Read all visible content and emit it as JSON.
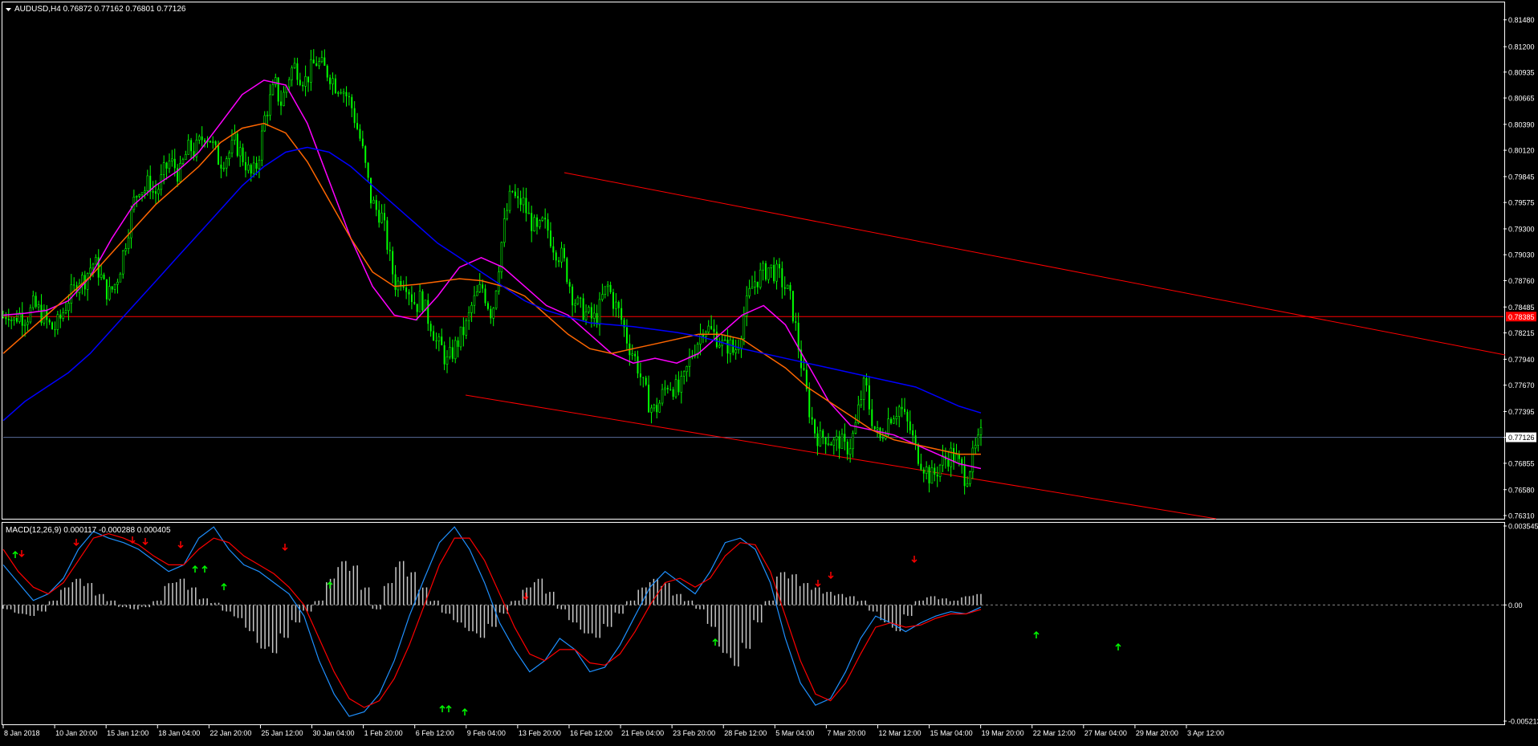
{
  "window": {
    "symbol_header": "AUDUSD,H4  0.76872 0.77162 0.76801 0.77126",
    "macd_header": "MACD(12,26,9) 0.000117 -0.000288 0.000405"
  },
  "colors": {
    "background": "#000000",
    "grid_border": "#ffffff",
    "candle_bull": "#00ff00",
    "candle_bear": "#00ff00",
    "ma_fast": "#ff00ff",
    "ma_mid": "#ff6600",
    "ma_slow": "#0000ff",
    "trend_lines": "#ff0000",
    "hline_price": "#ff0000",
    "hline_bid": "#5a6b9a",
    "macd_line": "#1e90ff",
    "signal_line": "#ff0000",
    "histogram": "#c8c8c8",
    "arrow_up": "#00ff00",
    "arrow_down": "#ff0000"
  },
  "price_axis": {
    "labels": [
      "0.81480",
      "0.81200",
      "0.80935",
      "0.80665",
      "0.80390",
      "0.80120",
      "0.79845",
      "0.79575",
      "0.79300",
      "0.79030",
      "0.78760",
      "0.78485",
      "0.78215",
      "0.77940",
      "0.77670",
      "0.77395",
      "0.77126",
      "0.76855",
      "0.76580",
      "0.76310"
    ],
    "highlight_red": "0.78385",
    "highlight_bid": "0.77126"
  },
  "macd_axis": {
    "labels": [
      "0.003545",
      "0.00",
      "-0.005213"
    ]
  },
  "time_axis": {
    "labels": [
      "8 Jan 2018",
      "10 Jan 20:00",
      "15 Jan 12:00",
      "18 Jan 04:00",
      "22 Jan 20:00",
      "25 Jan 12:00",
      "30 Jan 04:00",
      "1 Feb 20:00",
      "6 Feb 12:00",
      "9 Feb 04:00",
      "13 Feb 20:00",
      "16 Feb 12:00",
      "21 Feb 04:00",
      "23 Feb 20:00",
      "28 Feb 12:00",
      "5 Mar 04:00",
      "7 Mar 20:00",
      "12 Mar 12:00",
      "15 Mar 04:00",
      "19 Mar 20:00",
      "22 Mar 12:00",
      "27 Mar 04:00",
      "29 Mar 20:00",
      "3 Apr 12:00"
    ]
  },
  "chart_data": {
    "type": "line",
    "title": "AUDUSD,H4",
    "ylim": [
      0.7631,
      0.8162
    ],
    "price_anchors": [
      0.7838,
      0.7845,
      0.7832,
      0.7842,
      0.7838,
      0.784,
      0.785,
      0.7845,
      0.7838,
      0.783,
      0.7825,
      0.7832,
      0.7845,
      0.7858,
      0.7865,
      0.788,
      0.7875,
      0.7888,
      0.7895,
      0.7886,
      0.787,
      0.7862,
      0.787,
      0.7885,
      0.791,
      0.7935,
      0.796,
      0.7975,
      0.797,
      0.798,
      0.7965,
      0.7975,
      0.799,
      0.8,
      0.7995,
      0.7985,
      0.8005,
      0.8015,
      0.801,
      0.802,
      0.803,
      0.8025,
      0.801,
      0.8,
      0.8005,
      0.801,
      0.802,
      0.801,
      0.8,
      0.7985,
      0.799,
      0.8015,
      0.805,
      0.8065,
      0.808,
      0.806,
      0.8075,
      0.8095,
      0.81,
      0.809,
      0.8085,
      0.8095,
      0.8105,
      0.81,
      0.8095,
      0.809,
      0.808,
      0.808,
      0.807,
      0.806,
      0.804,
      0.802,
      0.799,
      0.796,
      0.795,
      0.7945,
      0.792,
      0.789,
      0.787,
      0.788,
      0.7875,
      0.786,
      0.785,
      0.786,
      0.784,
      0.783,
      0.781,
      0.7805,
      0.779,
      0.78,
      0.781,
      0.782,
      0.783,
      0.785,
      0.786,
      0.787,
      0.7855,
      0.784,
      0.788,
      0.792,
      0.795,
      0.797,
      0.7955,
      0.796,
      0.7945,
      0.7935,
      0.7925,
      0.7935,
      0.793,
      0.7915,
      0.7905,
      0.79,
      0.788,
      0.786,
      0.785,
      0.7845,
      0.784,
      0.7835,
      0.784,
      0.786,
      0.787,
      0.7855,
      0.7845,
      0.783,
      0.781,
      0.78,
      0.7785,
      0.7765,
      0.775,
      0.774,
      0.7745,
      0.776,
      0.777,
      0.7765,
      0.776,
      0.777,
      0.779,
      0.7805,
      0.7815,
      0.783,
      0.7825,
      0.782,
      0.7815,
      0.7805,
      0.781,
      0.78,
      0.7815,
      0.784,
      0.786,
      0.7875,
      0.788,
      0.7885,
      0.789,
      0.7885,
      0.788,
      0.787,
      0.786,
      0.7835,
      0.78,
      0.777,
      0.774,
      0.772,
      0.771,
      0.7715,
      0.771,
      0.7705,
      0.771,
      0.77,
      0.7705,
      0.772,
      0.775,
      0.777,
      0.774,
      0.772,
      0.771,
      0.7725,
      0.7735,
      0.774,
      0.7745,
      0.773,
      0.772,
      0.77,
      0.769,
      0.768,
      0.767,
      0.7675,
      0.7685,
      0.769,
      0.7695,
      0.769,
      0.768,
      0.767,
      0.7685,
      0.77,
      0.7713
    ],
    "series": [
      {
        "name": "MA fast",
        "values": [
          0.784,
          0.7842,
          0.7845,
          0.7855,
          0.788,
          0.792,
          0.7955,
          0.7975,
          0.799,
          0.801,
          0.804,
          0.807,
          0.8085,
          0.808,
          0.804,
          0.798,
          0.792,
          0.787,
          0.784,
          0.7835,
          0.786,
          0.789,
          0.79,
          0.789,
          0.787,
          0.785,
          0.784,
          0.782,
          0.78,
          0.779,
          0.7795,
          0.779,
          0.78,
          0.782,
          0.784,
          0.785,
          0.783,
          0.779,
          0.775,
          0.7725,
          0.772,
          0.7715,
          0.7705,
          0.7695,
          0.7685,
          0.768
        ]
      },
      {
        "name": "MA mid",
        "values": [
          0.78,
          0.782,
          0.784,
          0.786,
          0.788,
          0.7905,
          0.793,
          0.7955,
          0.7975,
          0.7995,
          0.802,
          0.8035,
          0.804,
          0.803,
          0.8,
          0.796,
          0.792,
          0.7885,
          0.787,
          0.7872,
          0.7875,
          0.7878,
          0.7876,
          0.787,
          0.786,
          0.784,
          0.782,
          0.7805,
          0.78,
          0.7805,
          0.781,
          0.7815,
          0.782,
          0.782,
          0.7815,
          0.78,
          0.7785,
          0.7765,
          0.775,
          0.7735,
          0.772,
          0.771,
          0.7705,
          0.77,
          0.7695,
          0.7695
        ]
      },
      {
        "name": "MA slow",
        "values": [
          0.773,
          0.775,
          0.7765,
          0.778,
          0.78,
          0.7825,
          0.785,
          0.7875,
          0.79,
          0.7925,
          0.795,
          0.7975,
          0.7995,
          0.801,
          0.8015,
          0.801,
          0.7995,
          0.7975,
          0.7955,
          0.7935,
          0.7915,
          0.79,
          0.7885,
          0.787,
          0.7855,
          0.7845,
          0.7838,
          0.7832,
          0.783,
          0.7828,
          0.7825,
          0.7822,
          0.7818,
          0.7812,
          0.7805,
          0.78,
          0.7795,
          0.779,
          0.7785,
          0.778,
          0.7775,
          0.777,
          0.7765,
          0.7755,
          0.7745,
          0.7738
        ]
      }
    ],
    "macd": {
      "ylim": [
        -0.005213,
        0.003545
      ],
      "histogram": [
        -0.0002,
        -0.0004,
        -0.0005,
        -0.0003,
        0.0002,
        0.0008,
        0.0012,
        0.001,
        0.0005,
        0.0002,
        -0.0001,
        -0.0002,
        -0.0001,
        0.0002,
        0.001,
        0.0012,
        0.0008,
        0.0003,
        0.0001,
        -0.0003,
        -0.0006,
        -0.0012,
        -0.002,
        -0.0022,
        -0.0015,
        -0.0008,
        -0.0003,
        0.0002,
        0.0012,
        0.002,
        0.0018,
        0.0008,
        -0.0002,
        0.001,
        0.002,
        0.0015,
        0.0008,
        0.0002,
        -0.0004,
        -0.0008,
        -0.0012,
        -0.0015,
        -0.001,
        -0.0004,
        0.0002,
        0.0008,
        0.0012,
        0.0006,
        -0.0002,
        -0.0008,
        -0.0013,
        -0.0015,
        -0.001,
        -0.0004,
        0.0002,
        0.0008,
        0.0012,
        0.001,
        0.0005,
        0.0002,
        -0.0002,
        -0.001,
        -0.0022,
        -0.0028,
        -0.002,
        -0.0008,
        0.0002,
        0.0015,
        0.0014,
        0.001,
        0.0008,
        0.0006,
        0.0005,
        0.0004,
        0.0002,
        -0.0003,
        -0.0008,
        -0.0012,
        -0.0005,
        0.0002,
        0.0004,
        0.0003,
        0.0002,
        0.0004,
        0.0005
      ],
      "macd_line": [
        0.0018,
        0.001,
        0.0002,
        0.0005,
        0.0012,
        0.0025,
        0.0033,
        0.003,
        0.0028,
        0.0025,
        0.002,
        0.0015,
        0.0018,
        0.003,
        0.0035,
        0.0025,
        0.0018,
        0.0015,
        0.001,
        0.0005,
        -0.0005,
        -0.0025,
        -0.004,
        -0.005,
        -0.0048,
        -0.004,
        -0.0025,
        -0.0005,
        0.0012,
        0.0028,
        0.0035,
        0.0025,
        0.001,
        -0.0008,
        -0.002,
        -0.003,
        -0.0025,
        -0.0015,
        -0.002,
        -0.003,
        -0.0028,
        -0.0018,
        -0.0005,
        0.0008,
        0.0015,
        0.001,
        0.0005,
        0.0015,
        0.0028,
        0.003,
        0.0025,
        0.001,
        -0.0015,
        -0.0035,
        -0.0045,
        -0.0042,
        -0.003,
        -0.0015,
        -0.0005,
        -0.0008,
        -0.0012,
        -0.0008,
        -0.0005,
        -0.0003,
        -0.0004,
        -0.0001
      ],
      "signal_line": [
        0.0025,
        0.0015,
        0.0008,
        0.0005,
        0.001,
        0.002,
        0.003,
        0.0032,
        0.003,
        0.0027,
        0.0022,
        0.0018,
        0.0018,
        0.0025,
        0.003,
        0.0028,
        0.0022,
        0.0018,
        0.0014,
        0.0008,
        0.0,
        -0.0015,
        -0.003,
        -0.0042,
        -0.0046,
        -0.0043,
        -0.0033,
        -0.0018,
        0.0,
        0.0018,
        0.003,
        0.003,
        0.002,
        0.0005,
        -0.001,
        -0.0022,
        -0.0025,
        -0.002,
        -0.002,
        -0.0026,
        -0.0027,
        -0.0022,
        -0.0012,
        0.0,
        0.001,
        0.0012,
        0.0008,
        0.0012,
        0.0022,
        0.0028,
        0.0027,
        0.0015,
        -0.0005,
        -0.0025,
        -0.004,
        -0.0043,
        -0.0035,
        -0.0022,
        -0.001,
        -0.0008,
        -0.001,
        -0.0009,
        -0.0006,
        -0.0004,
        -0.0004,
        -0.0002
      ]
    }
  }
}
